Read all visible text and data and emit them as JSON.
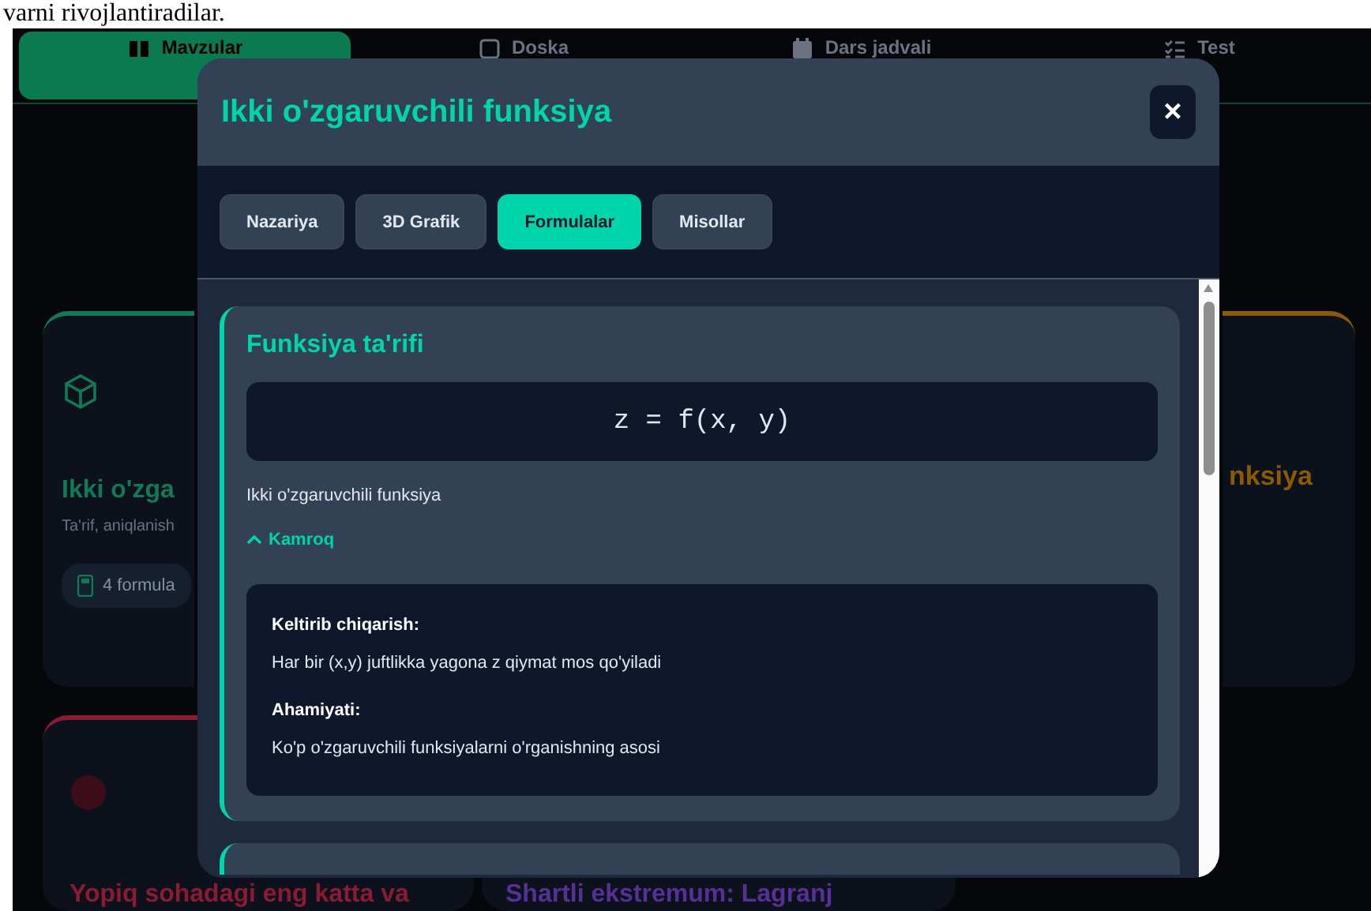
{
  "page_text": "varni rivojlantiradilar.",
  "nav_tabs": [
    {
      "label": "Mavzular",
      "selected": true
    },
    {
      "label": "Doska",
      "selected": false
    },
    {
      "label": "Dars jadvali",
      "selected": false
    },
    {
      "label": "Test",
      "selected": false
    }
  ],
  "topic_cards": [
    {
      "title": "Ikki o'zga",
      "subtitle": "Ta'rif, aniqlanish",
      "badge": "4 formula",
      "color": "#0f7a55"
    },
    {
      "title": "nksiya",
      "color": "#8a5a07"
    },
    {
      "title": "Yopiq sohadagi eng katta va",
      "color": "#8b1a33"
    },
    {
      "title": "Shartli ekstremum: Lagranj",
      "color": "#553096"
    }
  ],
  "modal": {
    "title": "Ikki o'zgaruvchili funksiya",
    "close": "×",
    "tabs": [
      {
        "label": "Nazariya",
        "selected": false
      },
      {
        "label": "3D Grafik",
        "selected": false
      },
      {
        "label": "Formulalar",
        "selected": true
      },
      {
        "label": "Misollar",
        "selected": false
      }
    ],
    "formula_cards": [
      {
        "title": "Funksiya ta'rifi",
        "formula": "z = f(x, y)",
        "description": "Ikki o'zgaruvchili funksiya",
        "toggle": "Kamroq",
        "expanded": true,
        "details": [
          {
            "label": "Keltirib chiqarish:",
            "text": "Har bir (x,y) juftlikka yagona z qiymat mos qo'yiladi"
          },
          {
            "label": "Ahamiyati:",
            "text": "Ko'p o'zgaruvchili funksiyalarni o'rganishning asosi"
          }
        ]
      }
    ]
  }
}
